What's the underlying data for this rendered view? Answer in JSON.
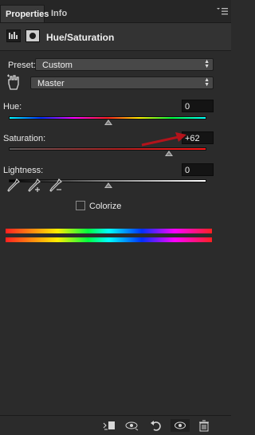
{
  "tabs": [
    {
      "label": "Properties",
      "active": true
    },
    {
      "label": "Info",
      "active": false
    }
  ],
  "header": {
    "title": "Hue/Saturation"
  },
  "preset": {
    "label": "Preset:",
    "value": "Custom"
  },
  "channel": {
    "value": "Master"
  },
  "hue": {
    "label": "Hue:",
    "value": "0",
    "level": 0
  },
  "saturation": {
    "label": "Saturation:",
    "value": "+62",
    "level": 62
  },
  "lightness": {
    "label": "Lightness:",
    "value": "0",
    "level": 0
  },
  "colorize": {
    "label": "Colorize",
    "checked": false
  },
  "colors": {
    "annotation_arrow": "#b3131b",
    "panel_bg": "#2b2b2b"
  },
  "icons": {
    "header": [
      "adjustment-layer-icon",
      "mask-icon"
    ],
    "tools": [
      "targeted-adjustment-hand-icon",
      "eyedropper-icon",
      "eyedropper-plus-icon",
      "eyedropper-minus-icon"
    ],
    "footer": [
      "clip-to-layer-icon",
      "view-previous-state-icon",
      "reset-icon",
      "visibility-eye-icon",
      "trash-icon"
    ]
  }
}
